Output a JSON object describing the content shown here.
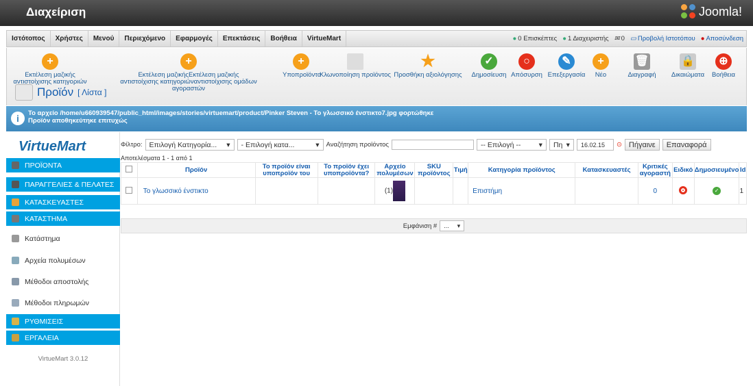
{
  "header": {
    "title": "Διαχείριση",
    "brand": "Joomla!"
  },
  "menu": {
    "items": [
      "Ιστότοπος",
      "Χρήστες",
      "Μενού",
      "Περιεχόμενο",
      "Εφαρμογές",
      "Επεκτάσεις",
      "Βοήθεια",
      "VirtueMart"
    ],
    "visitors": "0 Επισκέπτες",
    "admins": "1 Διαχειριστής",
    "messages": "0",
    "view_site": "Προβολή Ιστοτόπου",
    "logout": "Αποσύνδεση"
  },
  "toolbar": {
    "b1a": "Εκτέλεση μαζικής",
    "b1b": "αντιστοίχισης κατηγοριών",
    "b2a": "Εκτέλεση μαζικήςΕκτέλεση μαζικής",
    "b2b": "αντιστοίχισης κατηγοριώναντιστοίχισης ομάδων αγοραστών",
    "children": "Υποπροϊόντα",
    "clone": "Κλωνοποίηση προϊόντος",
    "rate": "Προσθήκη αξιολόγησης",
    "publish": "Δημοσίευση",
    "unpublish": "Απόσυρση",
    "edit": "Επεξεργασία",
    "new": "Νέο",
    "delete": "Διαγραφή",
    "perms": "Δικαιώματα",
    "help": "Βοήθεια"
  },
  "page": {
    "title": "Προϊόν",
    "subtitle": "[ Λίστα ]"
  },
  "message": {
    "line1": "Το αρχείο /home/u660939547/public_html/images/stories/virtuemart/product/Pinker Steven - Το γλωσσικό ένστικτο7.jpg φορτώθηκε",
    "line2": "Προϊόν αποθηκεύτηκε επιτυχώς"
  },
  "sidebar": {
    "logo": "VirtueMart",
    "items": [
      "ΠΡΟΪΟΝΤΑ",
      "ΠΑΡΑΓΓΕΛΙΕΣ & ΠΕΛΑΤΕΣ",
      "ΚΑΤΑΣΚΕΥΑΣΤΕΣ",
      "ΚΑΤΑΣΤΗΜΑ",
      "Κατάστημα",
      "Αρχεία πολυμέσων",
      "Μέθοδοι αποστολής",
      "Μέθοδοι πληρωμών",
      "ΡΥΘΜΙΣΕΙΣ",
      "ΕΡΓΑΛΕΙΑ"
    ],
    "version": "VirtueMart 3.0.12"
  },
  "filter": {
    "label": "Φίλτρο:",
    "category": "Επιλογή Κατηγορία...",
    "manufacturer": "- Επιλογή κατα...",
    "search_label": "Αναζήτηση προϊόντος",
    "select": "-- Επιλογή --",
    "comp": "Πη",
    "date": "16.02.15",
    "go": "Πήγαινε",
    "reset": "Επαναφορά"
  },
  "results": "Αποτελέσματα 1 - 1 από 1",
  "table": {
    "headers": [
      "Προϊόν",
      "Το προϊόν είναι υποπροϊόν του",
      "Το προϊόν έχει υποπροϊόντα?",
      "Αρχείο πολυμέσων",
      "SKU προϊόντος",
      "Τιμή",
      "Κατηγορία προϊόντος",
      "Κατασκευαστές",
      "Κριτικές αγοραστή",
      "Ειδικό",
      "Δημοσιευμένο",
      "Id"
    ],
    "row": {
      "name": "Το γλωσσικό ένστικτο",
      "media": "(1)",
      "category": "Επιστήμη",
      "reviews": "0",
      "id": "1"
    }
  },
  "display": {
    "label": "Εμφάνιση #",
    "value": "..."
  }
}
